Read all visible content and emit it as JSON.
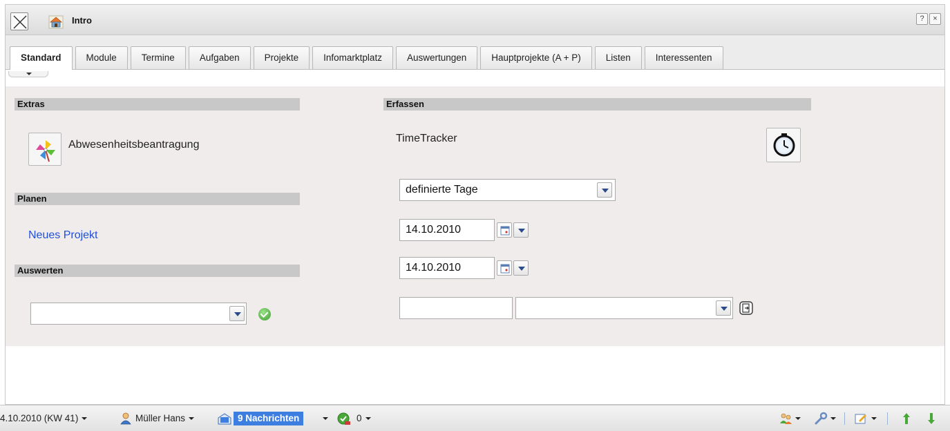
{
  "window": {
    "title": "Intro",
    "help_label": "?",
    "close_label": "×"
  },
  "tabs": [
    {
      "label": "Standard",
      "active": true
    },
    {
      "label": "Module"
    },
    {
      "label": "Termine"
    },
    {
      "label": "Aufgaben"
    },
    {
      "label": "Projekte"
    },
    {
      "label": "Infomarktplatz"
    },
    {
      "label": "Auswertungen"
    },
    {
      "label": "Hauptprojekte (A + P)"
    },
    {
      "label": "Listen"
    },
    {
      "label": "Interessenten"
    }
  ],
  "extras": {
    "header": "Extras",
    "item_label": "Abwesenheitsbeantragung",
    "item_icon": "pinwheel-icon"
  },
  "planen": {
    "header": "Planen",
    "link": "Neues Projekt"
  },
  "auswerten": {
    "header": "Auswerten",
    "select_value": ""
  },
  "erfassen": {
    "header": "Erfassen",
    "tracker_label": "TimeTracker",
    "tracker_icon": "clock-icon",
    "mode_select": "definierte Tage",
    "date_from": "14.10.2010",
    "date_to": "14.10.2010",
    "text_value": "",
    "type_select": ""
  },
  "statusbar": {
    "date": "4.10.2010 (KW 41)",
    "user": "Müller Hans",
    "messages": "9 Nachrichten",
    "tasks_count": "0"
  },
  "colors": {
    "accent": "#3d7fe0",
    "link": "#1d4fd8",
    "panel_bg": "#f0ecec",
    "section_bar": "#c8c8c8"
  }
}
